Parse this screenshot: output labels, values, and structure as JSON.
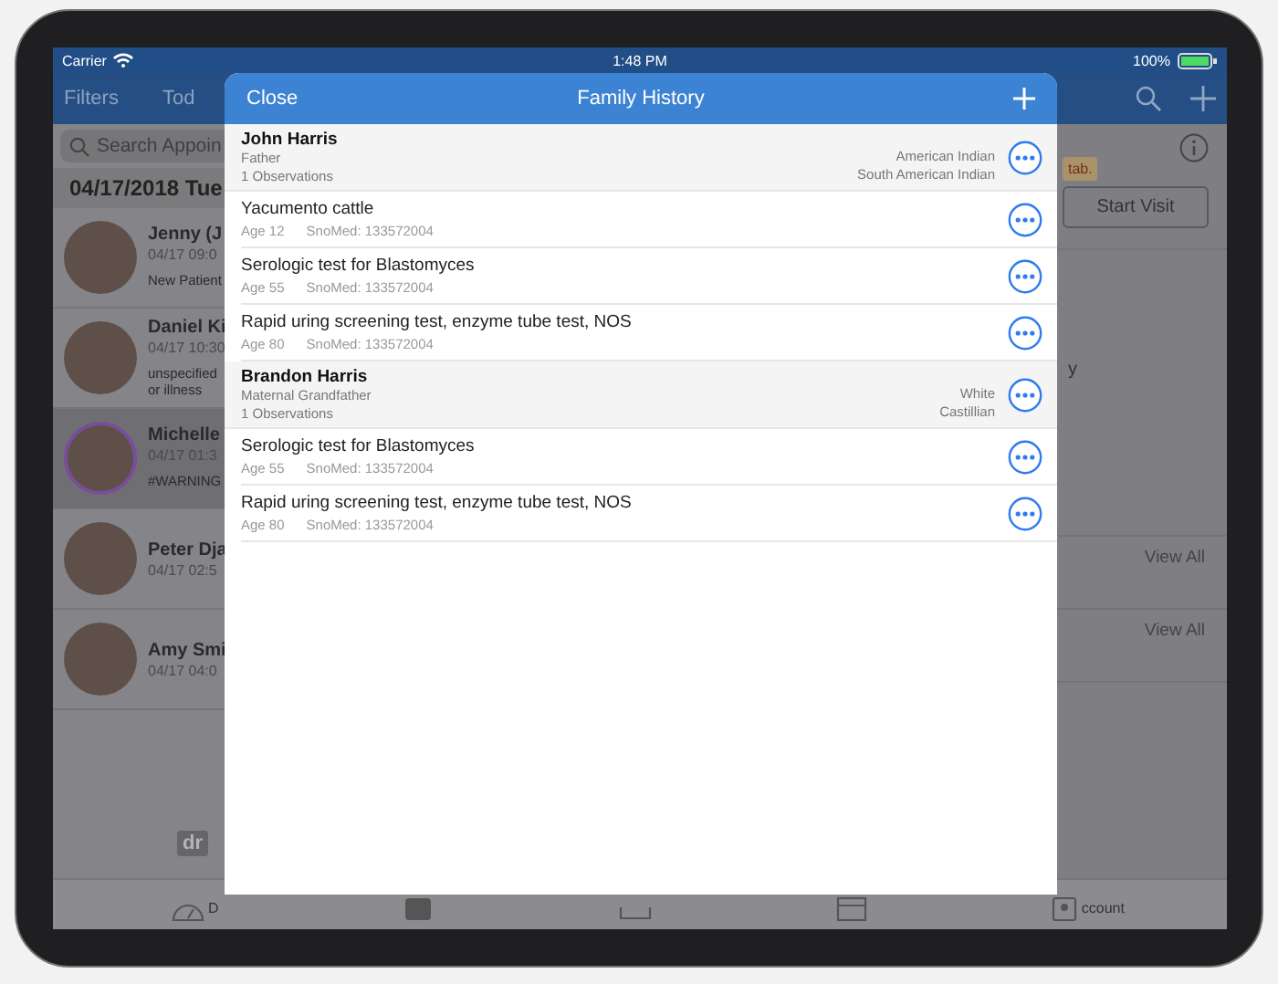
{
  "status_bar": {
    "carrier": "Carrier",
    "time": "1:48 PM",
    "battery": "100%"
  },
  "nav_bar": {
    "left": "Filters",
    "segment": "Tod"
  },
  "search": {
    "placeholder": "Search Appoin"
  },
  "date_header": "04/17/2018 Tue",
  "patients": [
    {
      "name": "Jenny (J",
      "time": "04/17 09:0",
      "note": "New Patient",
      "selected": false
    },
    {
      "name": "Daniel Ki",
      "time": "04/17 10:30",
      "note": "unspecified\nor illness",
      "selected": false
    },
    {
      "name": "Michelle",
      "time": "04/17 01:3",
      "note": "#WARNING",
      "selected": true
    },
    {
      "name": "Peter Dja",
      "time": "04/17 02:5",
      "selected": false
    },
    {
      "name": "Amy Smi",
      "time": "04/17 04:0",
      "selected": false
    }
  ],
  "logo": {
    "mark": "dr"
  },
  "detail": {
    "badge": "tab.",
    "start_button": "Start Visit",
    "fragment": "y",
    "view_all": [
      "View All",
      "View All"
    ]
  },
  "tab_bar": {
    "first_label": "D",
    "last_label": "ccount"
  },
  "modal": {
    "close": "Close",
    "title": "Family History",
    "groups": [
      {
        "name": "John Harris",
        "relation": "Father",
        "observations": "1 Observations",
        "ethnicity": [
          "American Indian",
          "South American Indian"
        ],
        "conditions": [
          {
            "name": "Yacumento cattle",
            "age": "Age 12",
            "code": "SnoMed: 133572004"
          },
          {
            "name": "Serologic test for Blastomyces",
            "age": "Age 55",
            "code": "SnoMed: 133572004"
          },
          {
            "name": "Rapid uring screening test, enzyme tube test, NOS",
            "age": "Age 80",
            "code": "SnoMed: 133572004"
          }
        ]
      },
      {
        "name": "Brandon Harris",
        "relation": "Maternal Grandfather",
        "observations": "1 Observations",
        "ethnicity": [
          "White",
          "Castillian"
        ],
        "conditions": [
          {
            "name": "Serologic test for Blastomyces",
            "age": "Age 55",
            "code": "SnoMed: 133572004"
          },
          {
            "name": "Rapid uring screening test, enzyme tube test, NOS",
            "age": "Age 80",
            "code": "SnoMed: 133572004"
          }
        ]
      }
    ]
  }
}
